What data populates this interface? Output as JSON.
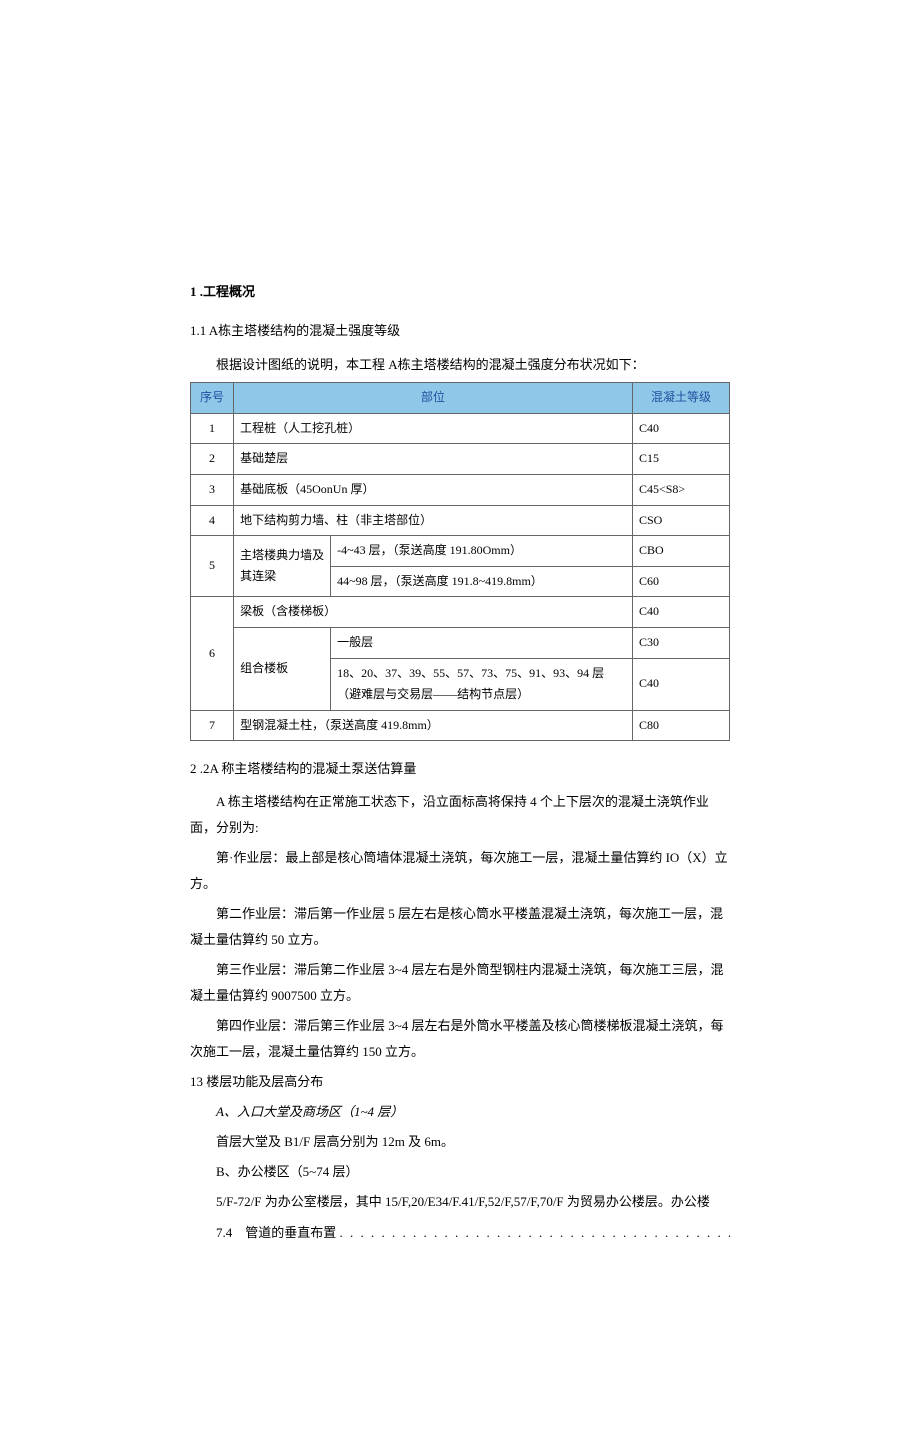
{
  "h1": "1 .工程概况",
  "h2_1": "1.1   A栋主塔楼结构的混凝土强度等级",
  "intro_1": "根据设计图纸的说明，本工程 A栋主塔楼结构的混凝土强度分布状况如下：",
  "table": {
    "headers": {
      "c1": "序号",
      "c2": "部位",
      "c3": "混凝土等级"
    },
    "r1": {
      "no": "1",
      "pos": "工程桩（人工挖孔桩）",
      "grade": "C40"
    },
    "r2": {
      "no": "2",
      "pos": "基础楚层",
      "grade": "C15"
    },
    "r3": {
      "no": "3",
      "pos": "基础底板（45OonUn 厚）",
      "grade": "C45<S8>"
    },
    "r4": {
      "no": "4",
      "pos": "地下结构剪力墙、柱（非主塔部位）",
      "grade": "CSO"
    },
    "r5": {
      "no": "5",
      "pos1": "主塔楼典力墙及其连梁",
      "sub1_pos": "-4~43 层，（泵送高度 191.80Omm）",
      "sub1_grade": "CBO",
      "sub2_pos": "44~98 层，（泵送高度 191.8~419.8mm）",
      "sub2_grade": "C60"
    },
    "r6": {
      "no": "6",
      "sub1_pos": "梁板（含楼梯板）",
      "sub1_grade": "C40",
      "pos2": "组合楼板",
      "sub2_pos": "一般层",
      "sub2_grade": "C30",
      "sub3_pos": "18、20、37、39、55、57、73、75、91、93、94 层（避难层与交易层——结构节点层）",
      "sub3_grade": "C40"
    },
    "r7": {
      "no": "7",
      "pos": "型钢混凝土柱，（泵送高度 419.8mm）",
      "grade": "C80"
    }
  },
  "h2_2": "2  .2A 称主塔楼结构的混凝土泵送估算量",
  "p1": "A 栋主塔楼结构在正常施工状态下，沿立面标高将保持 4 个上下层次的混凝土浇筑作业面，分别为:",
  "p2": "第·作业层：最上部是核心筒墙体混凝土浇筑，每次施工一层，混凝土量估算约 IO（X）立方。",
  "p3": "第二作业层：滞后第一作业层 5 层左右是核心筒水平楼盖混凝土浇筑，每次施工一层，混凝土量估算约 50 立方。",
  "p4": "第三作业层：滞后第二作业层 3~4 层左右是外筒型钢柱内混凝土浇筑，每次施工三层，混凝土量估算约 9007500 立方。",
  "p5": "第四作业层：滞后第三作业层 3~4 层左右是外筒水平楼盖及核心筒楼梯板混凝土浇筑，每次施工一层，混凝土量估算约 150 立方。",
  "h3": "13 楼层功能及层高分布",
  "sub_a_title": "A、入口大堂及商场区（1~4 层）",
  "sub_a_body": "首层大堂及 B1/F 层高分别为 12m 及 6m。",
  "sub_b_title": "B、办公楼区（5~74 层）",
  "sub_b_body": "5/F-72/F 为办公室楼层，其中 15/F,20/E34/F.41/F,52/F,57/F,70/F 为贸易办公楼层。办公楼",
  "toc": {
    "num": "7.4",
    "title": "管道的垂直布置"
  }
}
